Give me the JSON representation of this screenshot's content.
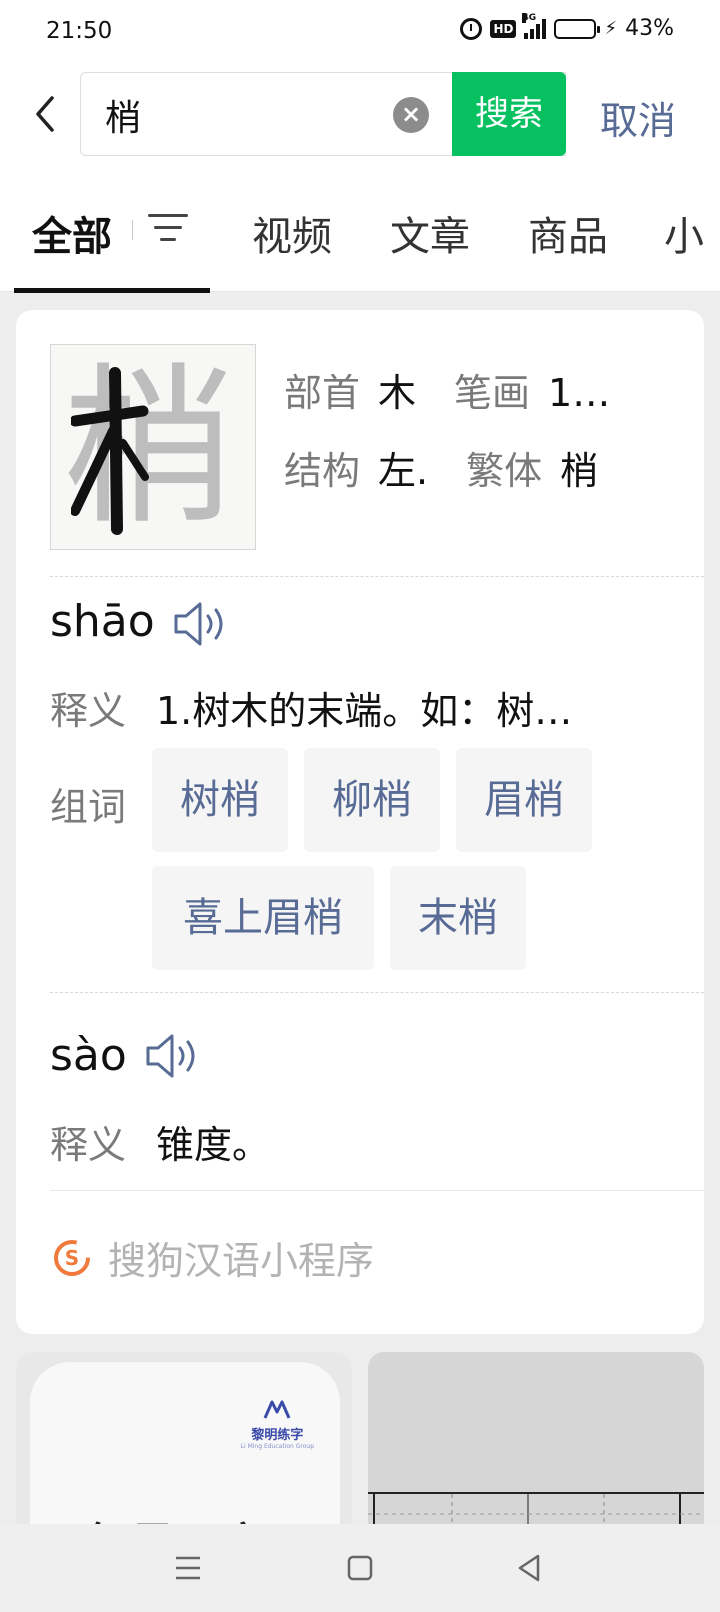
{
  "status_bar": {
    "time": "21:50",
    "hd": "HD",
    "network": "4G",
    "battery_level": 0.43,
    "battery_text": "43%"
  },
  "search": {
    "back": "back-arrow",
    "query": "梢",
    "search_button": "搜索",
    "cancel": "取消"
  },
  "tabs": [
    {
      "label": "全部",
      "active": true
    },
    {
      "label": "视频"
    },
    {
      "label": "文章"
    },
    {
      "label": "商品"
    },
    {
      "label": "小"
    }
  ],
  "dictionary": {
    "character": "梢",
    "radical_label": "部首",
    "radical": "木",
    "strokes_label": "笔画",
    "strokes": "1…",
    "structure_label": "结构",
    "structure": "左.",
    "traditional_label": "繁体",
    "traditional": "梢",
    "readings": [
      {
        "pinyin": "shāo",
        "definition_label": "释义",
        "definition": "1.树木的末端。如：树…",
        "words_label": "组词",
        "words": [
          "树梢",
          "柳梢",
          "眉梢",
          "喜上眉梢",
          "末梢"
        ]
      },
      {
        "pinyin": "sào",
        "definition_label": "释义",
        "definition": "锥度。"
      }
    ],
    "source": "搜狗汉语小程序"
  },
  "results": [
    {
      "brand": "黎明练字",
      "brand_sub": "Li Ming Education Group",
      "brush_text": "每周一字"
    }
  ],
  "colors": {
    "accent_green": "#07c160",
    "link_blue": "#576b95"
  }
}
